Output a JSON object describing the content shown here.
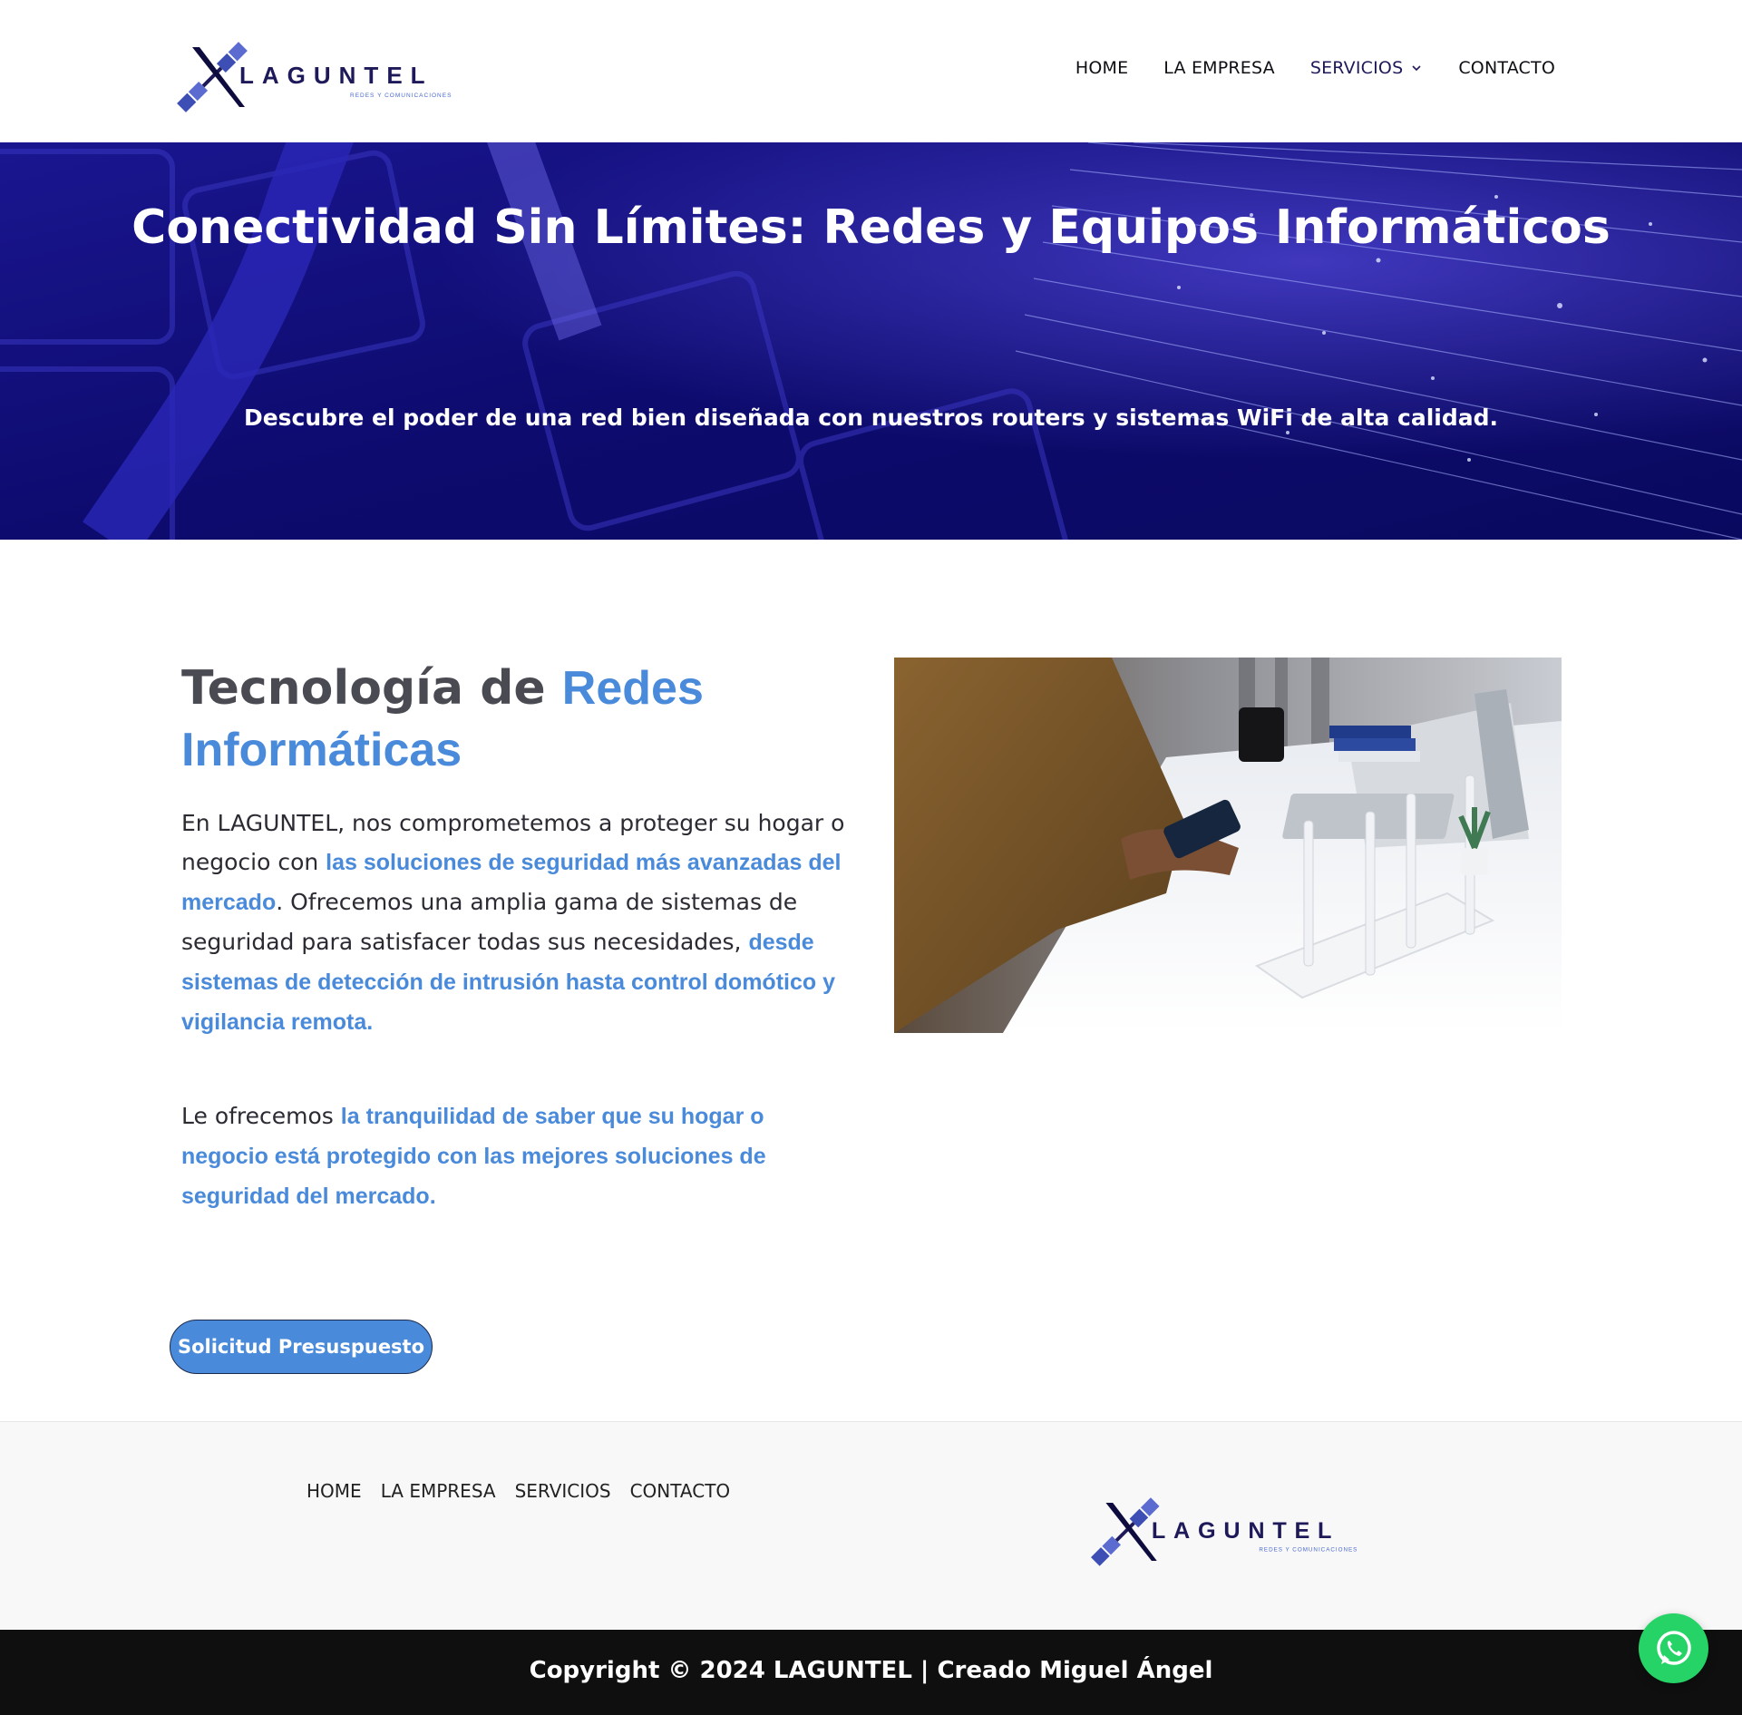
{
  "brand": {
    "name": "LAGUNTEL",
    "tagline": "REDES Y COMUNICACIONES",
    "primary_color": "#1e1a5a",
    "accent_color": "#4a8ada",
    "hero_color": "#12107a"
  },
  "nav": {
    "items": [
      {
        "label": "HOME"
      },
      {
        "label": "LA EMPRESA"
      },
      {
        "label": "SERVICIOS",
        "icon": "chevron-down-icon"
      },
      {
        "label": "CONTACTO"
      }
    ]
  },
  "hero": {
    "title": "Conectividad Sin Límites: Redes y Equipos Informáticos",
    "subtitle": "Descubre el poder de una red bien diseñada con nuestros routers y sistemas WiFi de alta calidad."
  },
  "main": {
    "heading_plain": "Tecnología de ",
    "heading_highlight": "Redes Informáticas",
    "para1": {
      "t1": "En LAGUNTEL, nos comprometemos a proteger su hogar o negocio con ",
      "h1": "las soluciones de seguridad más avanzadas del mercado",
      "t2": ". Ofrecemos una amplia gama de sistemas de seguridad para satisfacer todas sus necesidades, ",
      "h2": "desde sistemas de detección de intrusión hasta control domótico y vigilancia remota."
    },
    "para2": {
      "t1": "Le ofrecemos ",
      "h1": "la tranquilidad de saber que su hogar o negocio está protegido con las mejores soluciones de seguridad del mercado."
    },
    "cta_label": "Solicitud Presuspuesto"
  },
  "footer": {
    "links": [
      {
        "label": "HOME"
      },
      {
        "label": "LA EMPRESA"
      },
      {
        "label": "SERVICIOS"
      },
      {
        "label": "CONTACTO"
      }
    ],
    "copyright": "Copyright © 2024 LAGUNTEL | Creado Miguel Ángel"
  },
  "widgets": {
    "whatsapp_icon": "whatsapp-icon"
  }
}
